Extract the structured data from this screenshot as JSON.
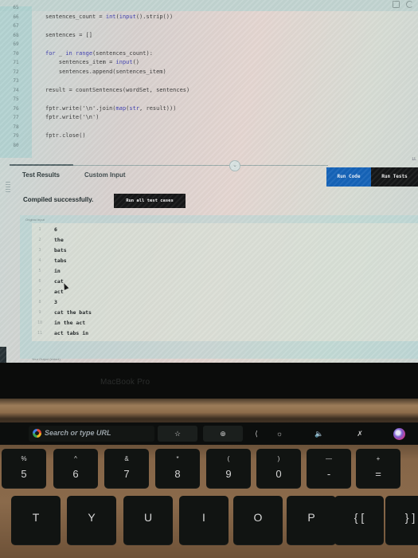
{
  "editor": {
    "lines": [
      {
        "num": "65",
        "code": ""
      },
      {
        "num": "66",
        "code": "sentences_count = int(input().strip())"
      },
      {
        "num": "67",
        "code": ""
      },
      {
        "num": "68",
        "code": "sentences = []"
      },
      {
        "num": "69",
        "code": ""
      },
      {
        "num": "70",
        "code": "for _ in range(sentences_count):"
      },
      {
        "num": "71",
        "code": "    sentences_item = input()"
      },
      {
        "num": "72",
        "code": "    sentences.append(sentences_item)"
      },
      {
        "num": "73",
        "code": ""
      },
      {
        "num": "74",
        "code": "result = countSentences(wordSet, sentences)"
      },
      {
        "num": "75",
        "code": ""
      },
      {
        "num": "76",
        "code": "fptr.write('\\n'.join(map(str, result)))"
      },
      {
        "num": "77",
        "code": "fptr.write('\\n')"
      },
      {
        "num": "78",
        "code": ""
      },
      {
        "num": "79",
        "code": "fptr.close()"
      },
      {
        "num": "80",
        "code": ""
      }
    ]
  },
  "panel": {
    "tabs": [
      {
        "label": "Test Results",
        "active": true
      },
      {
        "label": "Custom Input",
        "active": false
      }
    ],
    "run_code_label": "Run Code",
    "run_tests_label": "Run Tests",
    "compile_message": "Compiled successfully.",
    "run_all_label": "Run all test cases",
    "output_label": "Original Input",
    "output_lines": [
      {
        "num": "1",
        "text": "6"
      },
      {
        "num": "2",
        "text": "the"
      },
      {
        "num": "3",
        "text": "bats"
      },
      {
        "num": "4",
        "text": "tabs"
      },
      {
        "num": "5",
        "text": "in"
      },
      {
        "num": "6",
        "text": "cat"
      },
      {
        "num": "7",
        "text": "act"
      },
      {
        "num": "8",
        "text": "3"
      },
      {
        "num": "9",
        "text": "cat the bats"
      },
      {
        "num": "10",
        "text": "in the act"
      },
      {
        "num": "11",
        "text": "act tabs in"
      }
    ],
    "footer_label": "Your Output (stdout)",
    "colors": {
      "run_code": "#1563b8",
      "run_tests": "#141617"
    }
  },
  "laptop": {
    "brand": "MacBook Pro",
    "touchbar": {
      "url_placeholder": "Search or type URL",
      "icons": [
        "google-icon",
        "star-icon",
        "new-tab-icon",
        "collapse-chevron-icon",
        "brightness-icon",
        "volume-icon",
        "mute-icon",
        "siri-icon"
      ]
    },
    "keys_row1": [
      {
        "top": "%",
        "bot": "5"
      },
      {
        "top": "^",
        "bot": "6"
      },
      {
        "top": "&",
        "bot": "7"
      },
      {
        "top": "*",
        "bot": "8"
      },
      {
        "top": "(",
        "bot": "9"
      },
      {
        "top": ")",
        "bot": "0"
      },
      {
        "top": "—",
        "bot": "-"
      },
      {
        "top": "+",
        "bot": "="
      }
    ],
    "keys_row2": [
      "T",
      "Y",
      "U",
      "I",
      "O",
      "P",
      "{ [",
      "} ]"
    ]
  }
}
